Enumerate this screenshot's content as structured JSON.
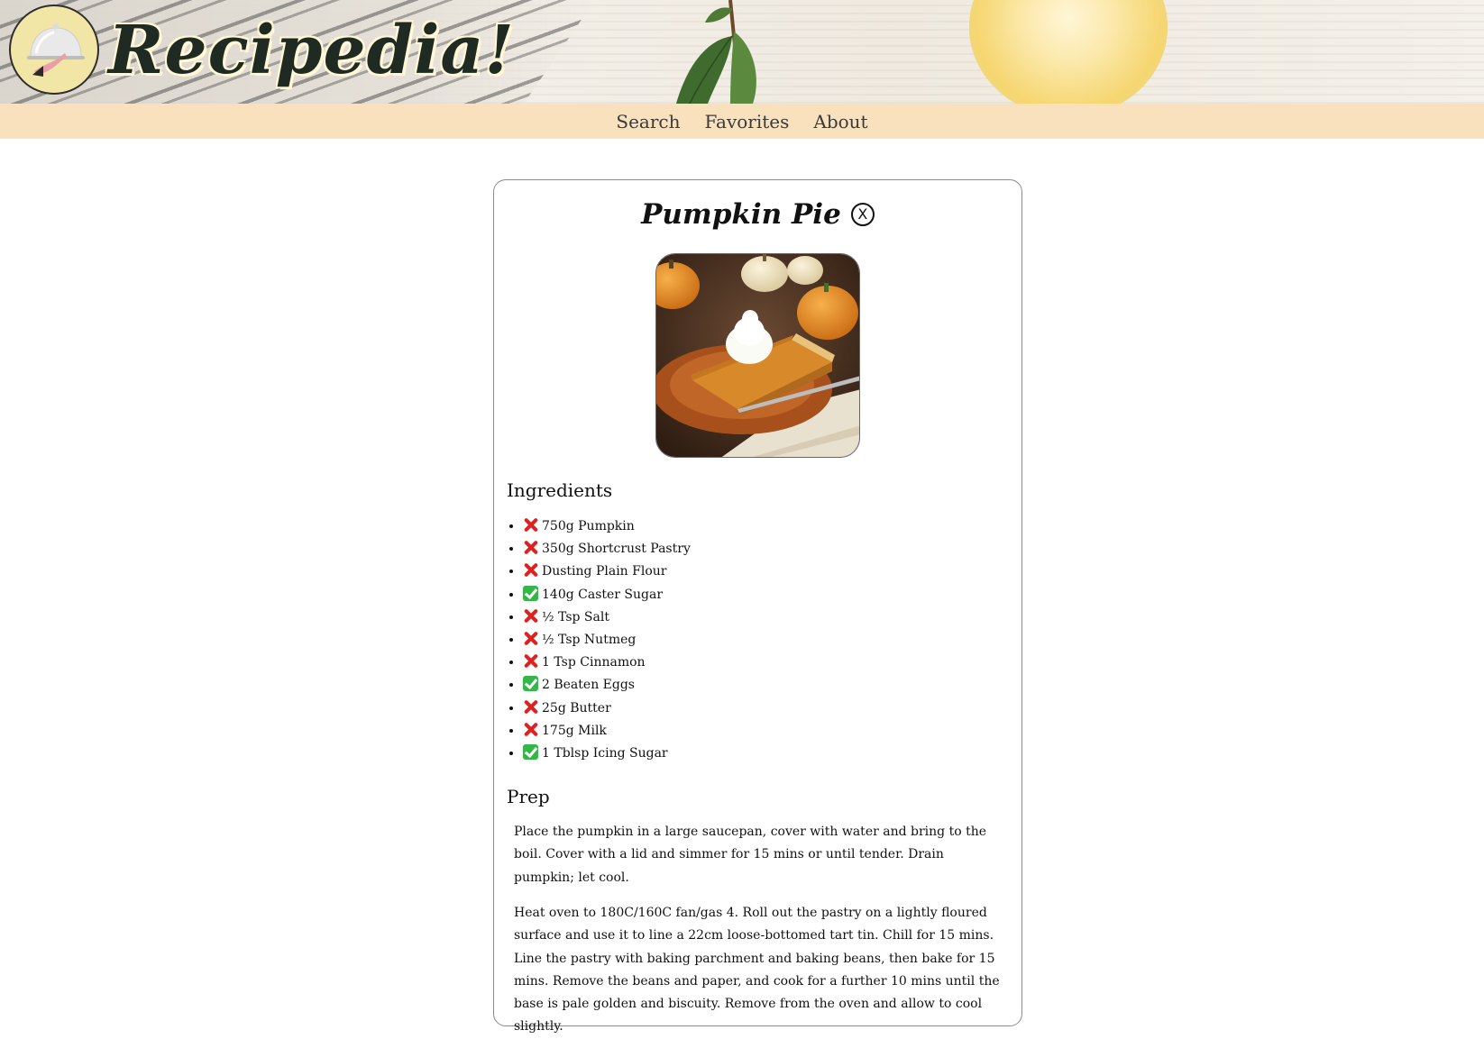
{
  "header": {
    "site_title": "Recipedia!",
    "logo_icon": "cloche-icon"
  },
  "nav": {
    "items": [
      {
        "label": "Search"
      },
      {
        "label": "Favorites"
      },
      {
        "label": "About"
      }
    ]
  },
  "recipe": {
    "title": "Pumpkin Pie",
    "close_label": "X",
    "photo_icon": "pumpkin-pie-photo",
    "ingredients_heading": "Ingredients",
    "ingredients": [
      {
        "text": "750g Pumpkin",
        "have": false
      },
      {
        "text": "350g Shortcrust Pastry",
        "have": false
      },
      {
        "text": "Dusting Plain Flour",
        "have": false
      },
      {
        "text": "140g Caster Sugar",
        "have": true
      },
      {
        "text": "½ Tsp Salt",
        "have": false
      },
      {
        "text": "½ Tsp Nutmeg",
        "have": false
      },
      {
        "text": "1 Tsp Cinnamon",
        "have": false
      },
      {
        "text": "2 Beaten Eggs",
        "have": true
      },
      {
        "text": "25g Butter",
        "have": false
      },
      {
        "text": "175g Milk",
        "have": false
      },
      {
        "text": "1 Tblsp Icing Sugar",
        "have": true
      }
    ],
    "prep_heading": "Prep",
    "prep_steps": [
      "Place the pumpkin in a large saucepan, cover with water and bring to the boil. Cover with a lid and simmer for 15 mins or until tender. Drain pumpkin; let cool.",
      "Heat oven to 180C/160C fan/gas 4. Roll out the pastry on a lightly floured surface and use it to line a 22cm loose-bottomed tart tin. Chill for 15 mins. Line the pastry with baking parchment and baking beans, then bake for 15 mins. Remove the beans and paper, and cook for a further 10 mins until the base is pale golden and biscuity. Remove from the oven and allow to cool slightly."
    ]
  },
  "colors": {
    "nav_background": "#fae1be",
    "missing_ingredient": "#e0201f",
    "have_ingredient": "#36b54a"
  }
}
